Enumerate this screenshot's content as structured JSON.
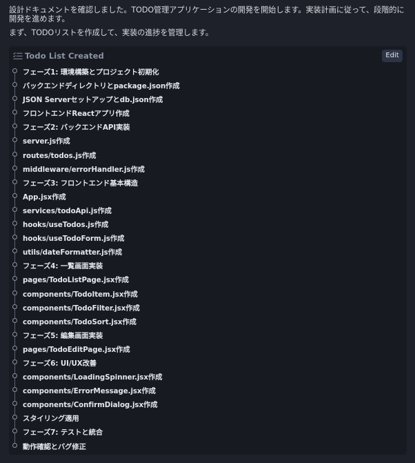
{
  "message": {
    "paragraph1": "設計ドキュメントを確認しました。TODO管理アプリケーションの開発を開始します。実装計画に従って、段階的に開発を進めます。",
    "paragraph2": "まず、TODOリストを作成して、実装の進捗を管理します。"
  },
  "card": {
    "icon": "checklist-icon",
    "title": "Todo List Created",
    "edit_label": "Edit",
    "items": [
      "フェーズ1: 環境構築とプロジェクト初期化",
      "バックエンドディレクトリとpackage.json作成",
      "JSON Serverセットアップとdb.json作成",
      "フロントエンドReactアプリ作成",
      "フェーズ2: バックエンドAPI実装",
      "server.js作成",
      "routes/todos.js作成",
      "middleware/errorHandler.js作成",
      "フェーズ3: フロントエンド基本構造",
      "App.jsx作成",
      "services/todoApi.js作成",
      "hooks/useTodos.js作成",
      "hooks/useTodoForm.js作成",
      "utils/dateFormatter.js作成",
      "フェーズ4: 一覧画面実装",
      "pages/TodoListPage.jsx作成",
      "components/TodoItem.jsx作成",
      "components/TodoFilter.jsx作成",
      "components/TodoSort.jsx作成",
      "フェーズ5: 編集画面実装",
      "pages/TodoEditPage.jsx作成",
      "フェーズ6: UI/UX改善",
      "components/LoadingSpinner.jsx作成",
      "components/ErrorMessage.jsx作成",
      "components/ConfirmDialog.jsx作成",
      "スタイリング適用",
      "フェーズ7: テストと統合",
      "動作確認とバグ修正"
    ]
  }
}
